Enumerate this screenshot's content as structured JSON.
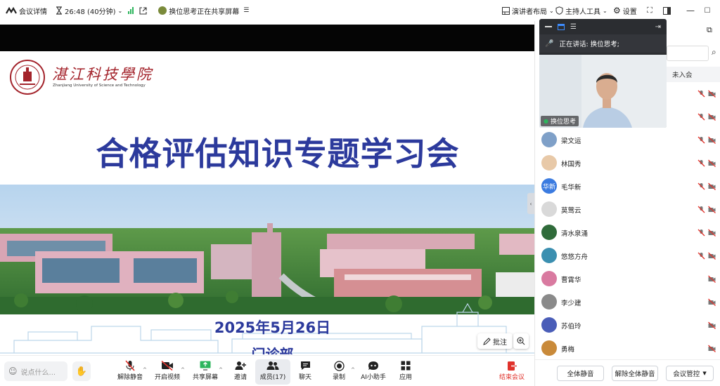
{
  "topbar": {
    "meeting_details": "会议详情",
    "timer": "26:48 (40分钟)",
    "sharing_status": "换位思考正在共享屏幕",
    "presenter_layout": "演讲者布局",
    "host_tools": "主持人工具",
    "settings": "设置"
  },
  "slide": {
    "school_name_cn": "湛江科技學院",
    "school_name_en": "Zhanjiang University of Science and Technology",
    "title": "合格评估知识专题学习会",
    "date": "2025年5月26日",
    "department": "门诊部"
  },
  "stage_controls": {
    "annotate": "批注"
  },
  "toolbar": {
    "chat_placeholder": "说点什么...",
    "unmute": "解除静音",
    "start_video": "开启视频",
    "share_screen": "共享屏幕",
    "invite": "邀请",
    "members": "成员(17)",
    "chat": "聊天",
    "record": "录制",
    "ai_assistant": "AI小助手",
    "apps": "应用",
    "end_meeting": "结束会议"
  },
  "video": {
    "speaking_label": "正在讲话: 换位思考;",
    "participant_name": "换位思考"
  },
  "panel": {
    "not_joined": "未入会",
    "participants": [
      {
        "name": "梁文运",
        "avatar_text": "",
        "avatar_color": "#7fa0c8",
        "muted_icons": true
      },
      {
        "name": "林国秀",
        "avatar_text": "",
        "avatar_color": "#e8c9a8",
        "muted_icons": true
      },
      {
        "name": "毛华新",
        "avatar_text": "华新",
        "avatar_color": "#3b7be0",
        "muted_icons": true
      },
      {
        "name": "莫莺云",
        "avatar_text": "",
        "avatar_color": "#d9d9d9",
        "muted_icons": true
      },
      {
        "name": "清水泉涌",
        "avatar_text": "",
        "avatar_color": "#2f6b3a",
        "muted_icons": true
      },
      {
        "name": "悠悠方舟",
        "avatar_text": "",
        "avatar_color": "#3b8fb0",
        "muted_icons": true
      },
      {
        "name": "曹霄华",
        "avatar_text": "",
        "avatar_color": "#d97aa0",
        "muted_icons": false
      },
      {
        "name": "李少建",
        "avatar_text": "",
        "avatar_color": "#8a8a8a",
        "muted_icons": false
      },
      {
        "name": "苏伯玲",
        "avatar_text": "",
        "avatar_color": "#4a5db8",
        "muted_icons": false
      },
      {
        "name": "勇梅",
        "avatar_text": "",
        "avatar_color": "#c98a3a",
        "muted_icons": false
      }
    ],
    "mute_all": "全体静音",
    "unmute_all": "解除全体静音",
    "meeting_control": "会议管控"
  },
  "colors": {
    "slide_title": "#2c3a9c",
    "end_meeting": "#e0322b",
    "muted_red": "#e0322b"
  }
}
